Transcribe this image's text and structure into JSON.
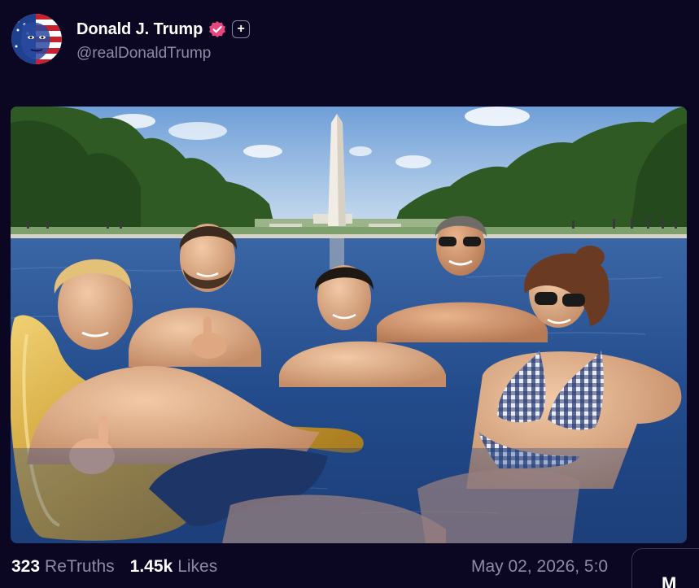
{
  "post": {
    "author": {
      "display_name": "Donald J. Trump",
      "handle": "@realDonaldTrump",
      "avatar_icon": "american-flag-face-avatar",
      "verified_icon": "verified-badge-icon",
      "follow_icon": "plus-icon",
      "follow_label": "+"
    },
    "media": {
      "kind": "photo",
      "icon": "photo"
    },
    "stats": {
      "retruths_count": "323",
      "retruths_label": "ReTruths",
      "likes_count": "1.45k",
      "likes_label": "Likes"
    },
    "timestamp": "May 02, 2026, 5:0",
    "more_label": "M"
  },
  "colors": {
    "background": "#0b0722",
    "muted_text": "#8e8aa3",
    "verified_badge": "#e8477e",
    "text": "#ffffff"
  }
}
